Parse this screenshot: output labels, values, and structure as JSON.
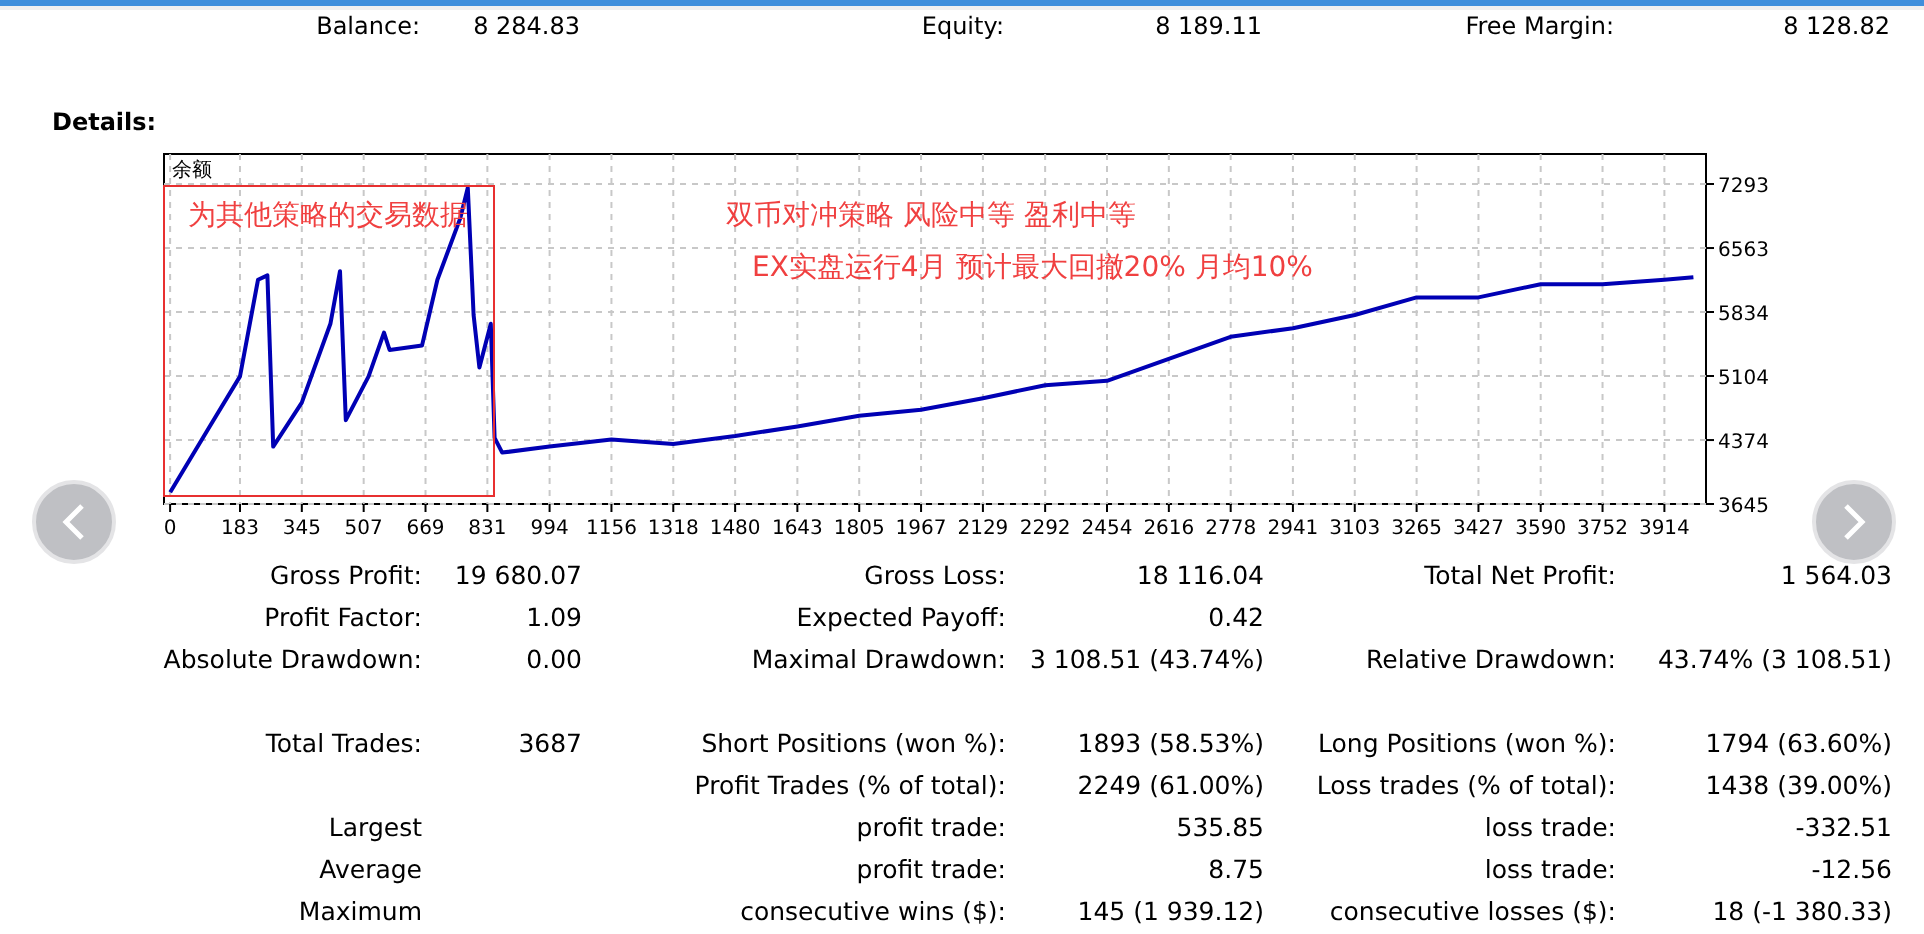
{
  "summary": [
    {
      "label": "Balance:",
      "value": "8 284.83"
    },
    {
      "label": "Equity:",
      "value": "8 189.11"
    },
    {
      "label": "Free Margin:",
      "value": "8 128.82"
    }
  ],
  "details_title": "Details:",
  "chart": {
    "chart_data": {
      "type": "line",
      "x": [
        0,
        100,
        183,
        230,
        255,
        270,
        345,
        420,
        445,
        460,
        520,
        560,
        575,
        660,
        700,
        760,
        780,
        795,
        810,
        840,
        850,
        870,
        994,
        1156,
        1318,
        1480,
        1643,
        1805,
        1967,
        2129,
        2292,
        2454,
        2616,
        2778,
        2941,
        3103,
        3265,
        3427,
        3590,
        3752,
        3914,
        3990
      ],
      "series": [
        {
          "name": "余额",
          "color": "#0000b4",
          "values": [
            3780,
            4500,
            5100,
            6200,
            6250,
            4300,
            4800,
            5700,
            6300,
            4600,
            5100,
            5600,
            5400,
            5450,
            6200,
            6900,
            7250,
            5800,
            5200,
            5700,
            4400,
            4230,
            4300,
            4380,
            4330,
            4420,
            4530,
            4650,
            4720,
            4850,
            5000,
            5050,
            5300,
            5550,
            5650,
            5800,
            6000,
            6000,
            6150,
            6150,
            6200,
            6230
          ]
        }
      ],
      "xlim": [
        -16,
        4023
      ],
      "ylim": [
        3645,
        7293
      ],
      "grid": true,
      "xticks": [
        0,
        183,
        345,
        507,
        669,
        831,
        994,
        1156,
        1318,
        1480,
        1643,
        1805,
        1967,
        2129,
        2292,
        2454,
        2616,
        2778,
        2941,
        3103,
        3265,
        3427,
        3590,
        3752,
        3914
      ],
      "yticks": [
        3645,
        4374,
        5104,
        5834,
        6563,
        7293
      ],
      "annotations": [
        "为其他策略的交易数据",
        "双币对冲策略 风险中等 盈利中等",
        "EX实盘运行4月 预计最大回撤20%  月均10%"
      ]
    }
  },
  "stat_groups": [
    [
      {
        "col1": {
          "label": "Gross Profit:",
          "value": "19 680.07"
        },
        "col2": {
          "label": "Gross Loss:",
          "value": "18 116.04"
        },
        "col3": {
          "label": "Total Net Profit:",
          "value": "1 564.03"
        }
      },
      {
        "col1": {
          "label": "Profit Factor:",
          "value": "1.09"
        },
        "col2": {
          "label": "Expected Payoff:",
          "value": "0.42"
        }
      },
      {
        "col1": {
          "label": "Absolute Drawdown:",
          "value": "0.00"
        },
        "col2": {
          "label": "Maximal Drawdown:",
          "value": "3 108.51 (43.74%)"
        },
        "col3": {
          "label": "Relative Drawdown:",
          "value": "43.74% (3 108.51)"
        }
      }
    ],
    [
      {
        "col1": {
          "label": "Total Trades:",
          "value": "3687"
        },
        "col2": {
          "label": "Short Positions (won %):",
          "value": "1893 (58.53%)"
        },
        "col3": {
          "label": "Long Positions (won %):",
          "value": "1794 (63.60%)"
        }
      },
      {
        "col2": {
          "label": "Profit Trades (% of total):",
          "value": "2249 (61.00%)"
        },
        "col3": {
          "label": "Loss trades (% of total):",
          "value": "1438 (39.00%)"
        }
      },
      {
        "col1": {
          "label": "Largest"
        },
        "col2": {
          "label": "profit trade:",
          "value": "535.85"
        },
        "col3": {
          "label": "loss trade:",
          "value": "-332.51"
        }
      },
      {
        "col1": {
          "label": "Average"
        },
        "col2": {
          "label": "profit trade:",
          "value": "8.75"
        },
        "col3": {
          "label": "loss trade:",
          "value": "-12.56"
        }
      },
      {
        "col1": {
          "label": "Maximum"
        },
        "col2": {
          "label": "consecutive wins ($):",
          "value": "145 (1 939.12)"
        },
        "col3": {
          "label": "consecutive losses ($):",
          "value": "18 (-1 380.33)"
        }
      }
    ]
  ]
}
